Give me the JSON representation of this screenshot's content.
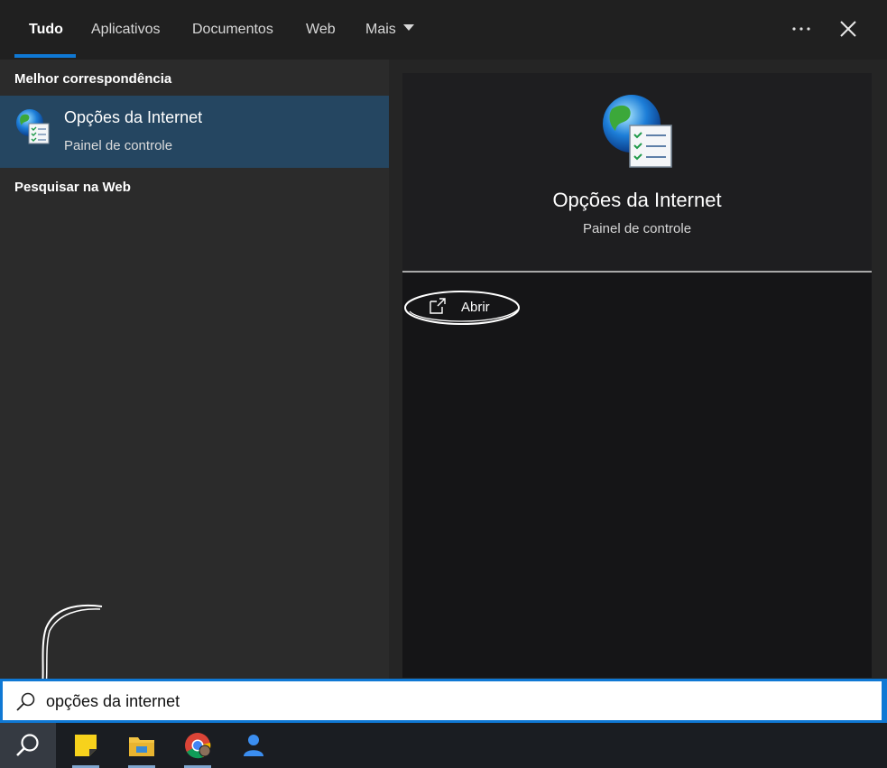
{
  "tabs": [
    {
      "label": "Tudo",
      "active": true
    },
    {
      "label": "Aplicativos"
    },
    {
      "label": "Documentos"
    },
    {
      "label": "Web"
    },
    {
      "label": "Mais"
    }
  ],
  "icons": {
    "more": "more-dots-icon",
    "close": "close-icon",
    "app": "internet-options-icon",
    "open": "open-external-icon",
    "search": "search-icon"
  },
  "results": {
    "best_match_heading": "Melhor correspondência",
    "best_match": {
      "title": "Opções da Internet",
      "subtitle": "Painel de controle"
    },
    "web_heading": "Pesquisar na Web"
  },
  "detail": {
    "title": "Opções da Internet",
    "subtitle": "Painel de controle",
    "actions": [
      {
        "label": "Abrir",
        "icon": "open-external-icon"
      }
    ]
  },
  "search": {
    "value": "opções da internet"
  },
  "taskbar": {
    "items": [
      "search-icon",
      "sticky-notes-icon",
      "file-explorer-icon",
      "chrome-icon",
      "people-icon"
    ]
  },
  "colors": {
    "accent": "#0f78d4",
    "selected_row": "#254661"
  }
}
